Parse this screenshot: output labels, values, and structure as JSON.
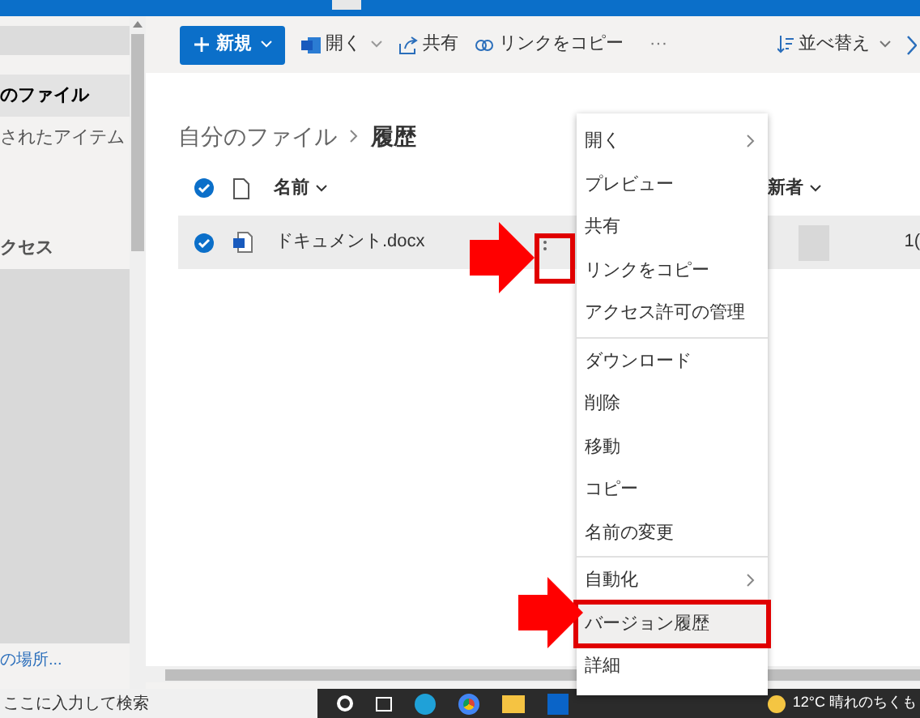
{
  "sidebar": {
    "items": [
      {
        "label": "のファイル",
        "selected": true
      },
      {
        "label": "されたアイテム",
        "selected": false
      },
      {
        "label": "クセス",
        "selected": false
      }
    ],
    "footer_link": "の場所..."
  },
  "toolbar": {
    "buttons": [
      {
        "kind": "primary",
        "label": "新規"
      },
      {
        "kind": "open",
        "label": "開く"
      },
      {
        "kind": "share",
        "label": "共有"
      },
      {
        "kind": "link",
        "label": "リンクをコピー"
      },
      {
        "kind": "more",
        "label": "···"
      }
    ],
    "sort": "並べ替え"
  },
  "breadcrumb": {
    "parent": "自分のファイル",
    "current": "履歴"
  },
  "table": {
    "all_selected": true,
    "columns": [
      "名前",
      "新者"
    ],
    "rows": [
      {
        "name": "ドキュメント.docx",
        "selected": true,
        "column_3": "1("
      }
    ]
  },
  "context_menu": {
    "groups": [
      [
        {
          "label": "開く",
          "submenu": true,
          "highlighted": false
        },
        {
          "label": "プレビュー",
          "submenu": false,
          "highlighted": false
        },
        {
          "label": "共有",
          "submenu": false,
          "highlighted": false
        },
        {
          "label": "リンクをコピー",
          "submenu": false,
          "highlighted": false
        },
        {
          "label": "アクセス許可の管理",
          "submenu": false,
          "highlighted": false
        }
      ],
      [
        {
          "label": "ダウンロード",
          "submenu": false,
          "highlighted": false
        },
        {
          "label": "削除",
          "submenu": false,
          "highlighted": false
        },
        {
          "label": "移動",
          "submenu": false,
          "highlighted": false
        },
        {
          "label": "コピー",
          "submenu": false,
          "highlighted": false
        },
        {
          "label": "名前の変更",
          "submenu": false,
          "highlighted": false
        }
      ],
      [
        {
          "label": "自動化",
          "submenu": true,
          "highlighted": false
        },
        {
          "label": "バージョン履歴",
          "submenu": false,
          "highlighted": true
        },
        {
          "label": "詳細",
          "submenu": false,
          "highlighted": false
        }
      ]
    ]
  },
  "taskbar": {
    "search_placeholder": "ここに入力して検索",
    "weather": "12°C 晴れのちくも"
  }
}
